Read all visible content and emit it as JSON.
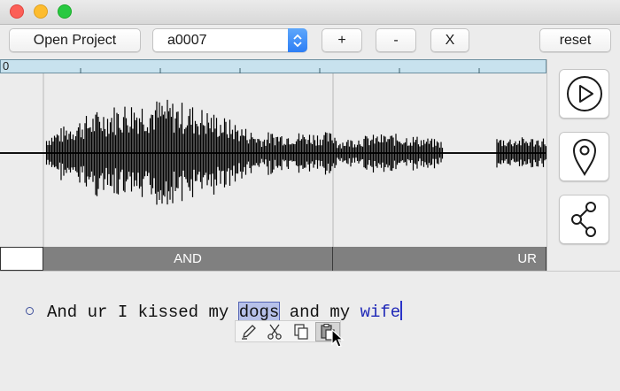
{
  "window": {
    "controls": [
      "close",
      "minimize",
      "zoom"
    ]
  },
  "toolbar": {
    "open_project_label": "Open Project",
    "recording_select_value": "a0007",
    "add_label": "+",
    "remove_label": "-",
    "close_label": "X",
    "reset_label": "reset"
  },
  "timeline": {
    "ruler_start_label": "0"
  },
  "segments": [
    {
      "label": ""
    },
    {
      "label": "AND"
    },
    {
      "label": "UR"
    }
  ],
  "side_tools": [
    {
      "icon": "play-icon"
    },
    {
      "icon": "location-pin-icon"
    },
    {
      "icon": "share-icon"
    }
  ],
  "transcript": {
    "words": [
      "And",
      "ur",
      "I",
      "kissed",
      "my",
      "dogs",
      "and",
      "my",
      "wife"
    ],
    "selected_word": "dogs",
    "edited_word": "wife"
  },
  "context_menu": {
    "icons": [
      "edit-icon",
      "cut-icon",
      "copy-icon",
      "paste-icon"
    ]
  },
  "colors": {
    "selected_word_bg": "#b7c1e9",
    "edited_word": "#2029b8",
    "segment_bar": "#808080",
    "ruler_bg": "#c8e2ee",
    "select_arrows": "#2d7ef5"
  }
}
